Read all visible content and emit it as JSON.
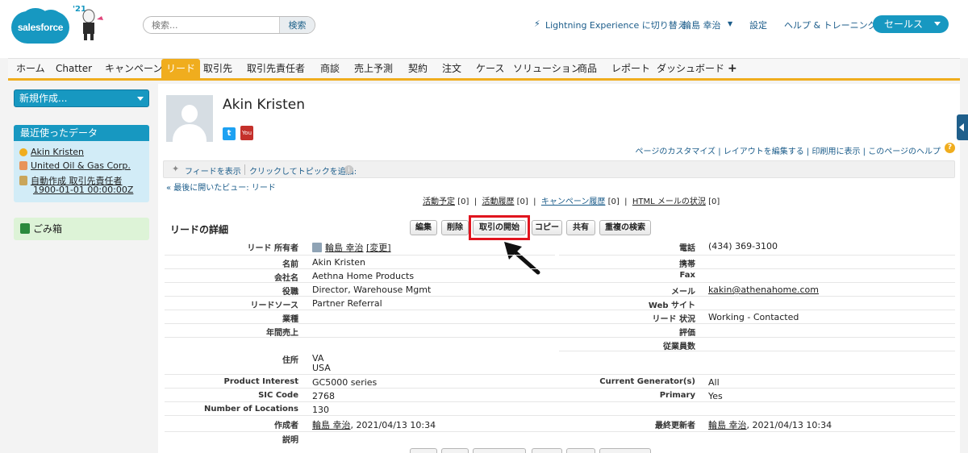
{
  "header": {
    "logo_text": "salesforce",
    "mascot_year": "'21",
    "search_placeholder": "検索...",
    "search_button": "検索",
    "lightning_switch": "Lightning Experience に切り替え",
    "user_menu": "輪島 幸治",
    "setup": "設定",
    "help": "ヘルプ & トレーニング",
    "app_switcher": "セールス",
    "accent_color": "#1798c1"
  },
  "tabs": [
    {
      "label": "ホーム"
    },
    {
      "label": "Chatter"
    },
    {
      "label": "キャンペーン"
    },
    {
      "label": "リード",
      "active": true
    },
    {
      "label": "取引先"
    },
    {
      "label": "取引先責任者"
    },
    {
      "label": "商談"
    },
    {
      "label": "売上予測"
    },
    {
      "label": "契約"
    },
    {
      "label": "注文"
    },
    {
      "label": "ケース"
    },
    {
      "label": "ソリューション"
    },
    {
      "label": "商品"
    },
    {
      "label": "レポート"
    },
    {
      "label": "ダッシュボード"
    },
    {
      "label": "+"
    }
  ],
  "sidebar": {
    "new_button": "新規作成...",
    "recent_title": "最近使ったデータ",
    "recent_items": [
      {
        "label": "Akin Kristen",
        "icon": "lead-icon"
      },
      {
        "label": "United Oil & Gas Corp.",
        "icon": "account-icon"
      },
      {
        "label": "自動作成 取引先責任者",
        "sub": "1900-01-01 00:00:00Z",
        "icon": "contact-icon"
      }
    ],
    "trash": "ごみ箱"
  },
  "record": {
    "name": "Akin Kristen",
    "page_links": "ページのカスタマイズ | レイアウトを編集する | 印刷用に表示 | このページのヘルプ",
    "feed_show": "フィードを表示",
    "feed_topic": "クリックしてトピックを追加:",
    "back_link": "« 最後に開いたビュー: リード",
    "related": {
      "activities": "活動予定",
      "activities_count": "[0]",
      "history": "活動履歴",
      "history_count": "[0]",
      "campaign": "キャンペーン履歴",
      "campaign_count": "[0]",
      "email": "HTML メールの状況",
      "email_count": "[0]"
    },
    "detail_title": "リードの詳細",
    "buttons": {
      "edit": "編集",
      "delete": "削除",
      "convert": "取引の開始",
      "copy": "コピー",
      "share": "共有",
      "duplicates": "重複の検索"
    },
    "fields": {
      "owner_label": "リード 所有者",
      "owner_value": "輪島 幸治",
      "owner_change": "[変更]",
      "name_label": "名前",
      "name_value": "Akin Kristen",
      "company_label": "会社名",
      "company_value": "Aethna Home Products",
      "title_label": "役職",
      "title_value": "Director, Warehouse Mgmt",
      "source_label": "リードソース",
      "source_value": "Partner Referral",
      "industry_label": "業種",
      "revenue_label": "年間売上",
      "address_label": "住所",
      "address_line1": "VA",
      "address_line2": "USA",
      "product_label": "Product Interest",
      "product_value": "GC5000 series",
      "sic_label": "SIC Code",
      "sic_value": "2768",
      "locations_label": "Number of Locations",
      "locations_value": "130",
      "created_label": "作成者",
      "created_user": "輪島 幸治",
      "created_date": ", 2021/04/13 10:34",
      "description_label": "説明",
      "phone_label": "電話",
      "phone_value": "(434) 369-3100",
      "mobile_label": "携帯",
      "fax_label": "Fax",
      "email_label": "メール",
      "email_value": "kakin@athenahome.com",
      "website_label": "Web サイト",
      "status_label": "リード 状況",
      "status_value": "Working - Contacted",
      "rating_label": "評価",
      "employees_label": "従業員数",
      "generator_label": "Current Generator(s)",
      "generator_value": "All",
      "primary_label": "Primary",
      "primary_value": "Yes",
      "modified_label": "最終更新者",
      "modified_user": "輪島 幸治",
      "modified_date": ", 2021/04/13 10:34"
    }
  }
}
